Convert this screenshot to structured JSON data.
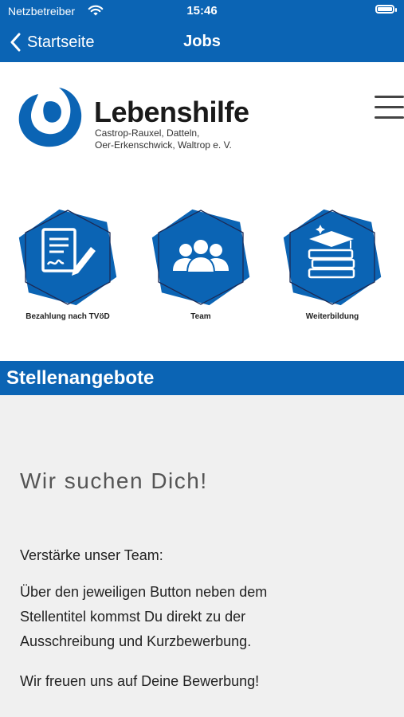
{
  "status_bar": {
    "carrier": "Netzbetreiber",
    "time": "15:46"
  },
  "nav": {
    "back_label": "Startseite",
    "title": "Jobs"
  },
  "logo": {
    "name": "Lebenshilfe",
    "subtitle_line1": "Castrop-Rauxel, Datteln,",
    "subtitle_line2": "Oer-Erkenschwick, Waltrop e. V."
  },
  "features": [
    {
      "label": "Bezahlung nach TVöD",
      "icon": "contract-sign-icon"
    },
    {
      "label": "Team",
      "icon": "team-people-icon"
    },
    {
      "label": "Weiterbildung",
      "icon": "books-graduation-cap-icon"
    }
  ],
  "section": {
    "title": "Stellenangebote"
  },
  "content": {
    "headline": "Wir suchen Dich!",
    "intro": "Verstärke unser Team:",
    "description_line1": "Über den jeweiligen Button neben dem",
    "description_line2": "Stellentitel kommst Du direkt zu der",
    "description_line3": "Ausschreibung und Kurzbewerbung.",
    "closing": "Wir freuen uns auf Deine Bewerbung!"
  },
  "colors": {
    "brand_blue": "#0b64b4",
    "background": "#f0f0f0"
  }
}
